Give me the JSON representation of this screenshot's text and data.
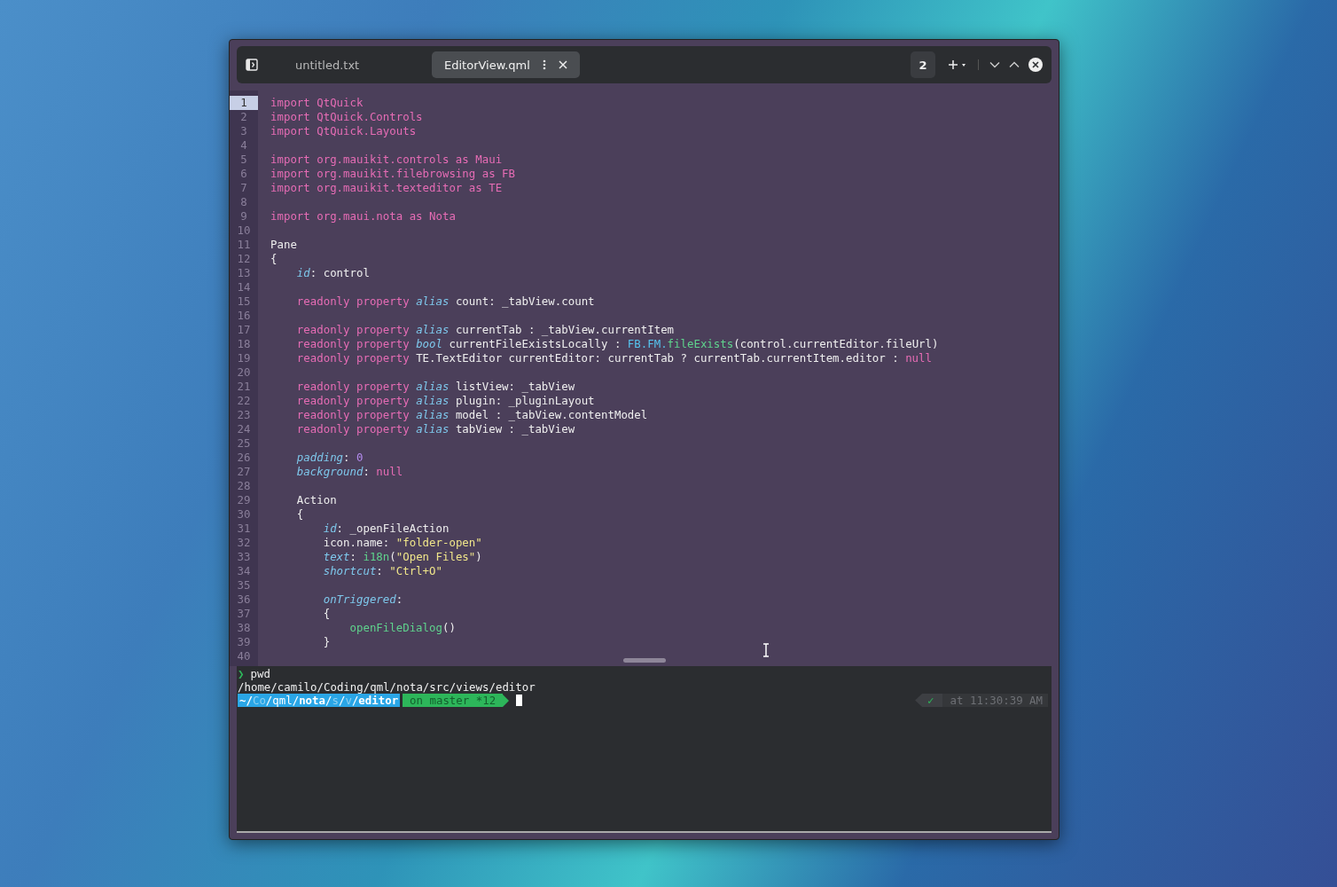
{
  "header": {
    "tabs": [
      {
        "label": "untitled.txt",
        "selected": false
      },
      {
        "label": "EditorView.qml",
        "selected": true
      }
    ],
    "tab_count": "2"
  },
  "editor": {
    "lines": [
      {
        "number": "1",
        "current": true,
        "tokens": [
          {
            "kind": "kw",
            "text": "import QtQuick"
          }
        ]
      },
      {
        "number": "2",
        "current": false,
        "tokens": [
          {
            "kind": "kw",
            "text": "import QtQuick.Controls"
          }
        ]
      },
      {
        "number": "3",
        "current": false,
        "tokens": [
          {
            "kind": "kw",
            "text": "import QtQuick.Layouts"
          }
        ]
      },
      {
        "number": "4",
        "current": false
      },
      {
        "number": "5",
        "current": false,
        "tokens": [
          {
            "kind": "kw",
            "text": "import org.mauikit.controls as Maui"
          }
        ]
      },
      {
        "number": "6",
        "current": false,
        "tokens": [
          {
            "kind": "kw",
            "text": "import org.mauikit.filebrowsing as FB"
          }
        ]
      },
      {
        "number": "7",
        "current": false,
        "tokens": [
          {
            "kind": "kw",
            "text": "import org.mauikit.texteditor as TE"
          }
        ]
      },
      {
        "number": "8",
        "current": false
      },
      {
        "number": "9",
        "current": false,
        "tokens": [
          {
            "kind": "kw",
            "text": "import org.maui.nota as Nota"
          }
        ]
      },
      {
        "number": "10",
        "current": false
      },
      {
        "number": "11",
        "current": false,
        "tokens": [
          {
            "kind": "plain",
            "text": "Pane"
          }
        ]
      },
      {
        "number": "12",
        "current": false,
        "tokens": [
          {
            "kind": "plain",
            "text": "{"
          }
        ]
      },
      {
        "number": "13",
        "current": false,
        "tokens": [
          {
            "kind": "prop",
            "text": "    id"
          },
          {
            "kind": "plain",
            "text": ": control"
          }
        ]
      },
      {
        "number": "14",
        "current": false
      },
      {
        "number": "15",
        "current": false,
        "tokens": [
          {
            "kind": "kw",
            "text": "    readonly property "
          },
          {
            "kind": "prop",
            "text": "alias"
          },
          {
            "kind": "plain",
            "text": " count: _tabView.count"
          }
        ]
      },
      {
        "number": "16",
        "current": false
      },
      {
        "number": "17",
        "current": false,
        "tokens": [
          {
            "kind": "kw",
            "text": "    readonly property "
          },
          {
            "kind": "prop",
            "text": "alias"
          },
          {
            "kind": "plain",
            "text": " currentTab : _tabView.currentItem"
          }
        ]
      },
      {
        "number": "18",
        "current": false,
        "tokens": [
          {
            "kind": "kw",
            "text": "    readonly property "
          },
          {
            "kind": "prop",
            "text": "bool"
          },
          {
            "kind": "plain",
            "text": " currentFileExistsLocally : "
          },
          {
            "kind": "ns",
            "text": "FB.FM."
          },
          {
            "kind": "fn",
            "text": "fileExists"
          },
          {
            "kind": "plain",
            "text": "(control.currentEditor.fileUrl)"
          }
        ]
      },
      {
        "number": "19",
        "current": false,
        "tokens": [
          {
            "kind": "kw",
            "text": "    readonly property "
          },
          {
            "kind": "plain",
            "text": "TE.TextEditor currentEditor: currentTab ? currentTab.currentItem.editor : "
          },
          {
            "kind": "kw",
            "text": "null"
          }
        ]
      },
      {
        "number": "20",
        "current": false
      },
      {
        "number": "21",
        "current": false,
        "tokens": [
          {
            "kind": "kw",
            "text": "    readonly property "
          },
          {
            "kind": "prop",
            "text": "alias"
          },
          {
            "kind": "plain",
            "text": " listView: _tabView"
          }
        ]
      },
      {
        "number": "22",
        "current": false,
        "tokens": [
          {
            "kind": "kw",
            "text": "    readonly property "
          },
          {
            "kind": "prop",
            "text": "alias"
          },
          {
            "kind": "plain",
            "text": " plugin: _pluginLayout"
          }
        ]
      },
      {
        "number": "23",
        "current": false,
        "tokens": [
          {
            "kind": "kw",
            "text": "    readonly property "
          },
          {
            "kind": "prop",
            "text": "alias"
          },
          {
            "kind": "plain",
            "text": " model : _tabView.contentModel"
          }
        ]
      },
      {
        "number": "24",
        "current": false,
        "tokens": [
          {
            "kind": "kw",
            "text": "    readonly property "
          },
          {
            "kind": "prop",
            "text": "alias"
          },
          {
            "kind": "plain",
            "text": " tabView : _tabView"
          }
        ]
      },
      {
        "number": "25",
        "current": false
      },
      {
        "number": "26",
        "current": false,
        "tokens": [
          {
            "kind": "prop",
            "text": "    padding"
          },
          {
            "kind": "plain",
            "text": ": "
          },
          {
            "kind": "num",
            "text": "0"
          }
        ]
      },
      {
        "number": "27",
        "current": false,
        "tokens": [
          {
            "kind": "prop",
            "text": "    background"
          },
          {
            "kind": "plain",
            "text": ": "
          },
          {
            "kind": "kw",
            "text": "null"
          }
        ]
      },
      {
        "number": "28",
        "current": false
      },
      {
        "number": "29",
        "current": false,
        "tokens": [
          {
            "kind": "plain",
            "text": "    Action"
          }
        ]
      },
      {
        "number": "30",
        "current": false,
        "tokens": [
          {
            "kind": "plain",
            "text": "    {"
          }
        ]
      },
      {
        "number": "31",
        "current": false,
        "tokens": [
          {
            "kind": "prop",
            "text": "        id"
          },
          {
            "kind": "plain",
            "text": ": _openFileAction"
          }
        ]
      },
      {
        "number": "32",
        "current": false,
        "tokens": [
          {
            "kind": "plain",
            "text": "        icon.name: "
          },
          {
            "kind": "str",
            "text": "\"folder-open\""
          }
        ]
      },
      {
        "number": "33",
        "current": false,
        "tokens": [
          {
            "kind": "prop",
            "text": "        text"
          },
          {
            "kind": "plain",
            "text": ": "
          },
          {
            "kind": "fn",
            "text": "i18n"
          },
          {
            "kind": "plain",
            "text": "("
          },
          {
            "kind": "str",
            "text": "\"Open Files\""
          },
          {
            "kind": "plain",
            "text": ")"
          }
        ]
      },
      {
        "number": "34",
        "current": false,
        "tokens": [
          {
            "kind": "prop",
            "text": "        shortcut"
          },
          {
            "kind": "plain",
            "text": ": "
          },
          {
            "kind": "str",
            "text": "\"Ctrl+O\""
          }
        ]
      },
      {
        "number": "35",
        "current": false
      },
      {
        "number": "36",
        "current": false,
        "tokens": [
          {
            "kind": "prop",
            "text": "        onTriggered"
          },
          {
            "kind": "plain",
            "text": ":"
          }
        ]
      },
      {
        "number": "37",
        "current": false,
        "tokens": [
          {
            "kind": "plain",
            "text": "        {"
          }
        ]
      },
      {
        "number": "38",
        "current": false,
        "tokens": [
          {
            "kind": "fn",
            "text": "            openFileDialog"
          },
          {
            "kind": "plain",
            "text": "()"
          }
        ]
      },
      {
        "number": "39",
        "current": false,
        "tokens": [
          {
            "kind": "plain",
            "text": "        }"
          }
        ]
      },
      {
        "number": "40",
        "current": false
      }
    ]
  },
  "terminal": {
    "prompt_symbol": "❯",
    "command": "pwd",
    "output": "/home/camilo/Coding/qml/nota/src/views/editor",
    "path_segments": [
      {
        "kind": "bold",
        "text": "~/"
      },
      {
        "kind": "dim",
        "text": "Co"
      },
      {
        "kind": "plain",
        "text": "/qml/"
      },
      {
        "kind": "bold",
        "text": "nota"
      },
      {
        "kind": "plain",
        "text": "/"
      },
      {
        "kind": "dim",
        "text": "s"
      },
      {
        "kind": "plain",
        "text": "/"
      },
      {
        "kind": "dim",
        "text": "v"
      },
      {
        "kind": "plain",
        "text": "/"
      },
      {
        "kind": "bold",
        "text": "editor"
      }
    ],
    "git": "on master *12",
    "status": "✓",
    "time": "at 11:30:39 AM"
  }
}
